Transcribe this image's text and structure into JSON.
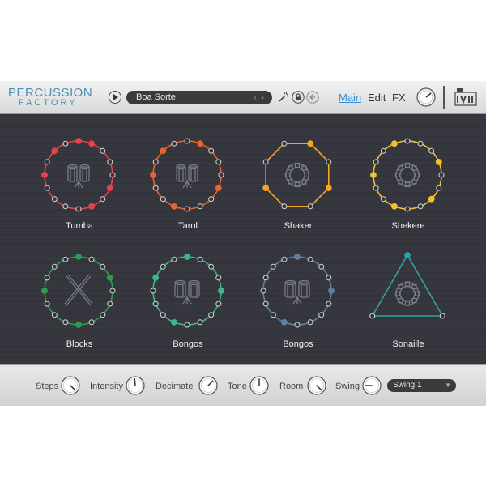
{
  "header": {
    "logo_line1": "PERCUSSION",
    "logo_line2": "FACTORY",
    "preset": "Boa Sorte",
    "preset_arrows": "‹ ›",
    "tabs": [
      "Main",
      "Edit",
      "FX"
    ],
    "active_tab": "Main",
    "accent_color": "#3d8fd1"
  },
  "pads": [
    {
      "name": "Tumba",
      "color": "#e8414c",
      "icon": "conga-drums-icon",
      "shape": "circle-16-steps"
    },
    {
      "name": "Tarol",
      "color": "#e8652e",
      "icon": "snare-drums-icon",
      "shape": "circle-16-steps"
    },
    {
      "name": "Shaker",
      "color": "#f5a623",
      "icon": "tambourine-icon",
      "shape": "octagon-8-steps"
    },
    {
      "name": "Shekere",
      "color": "#f2c12e",
      "icon": "tambourine-icon",
      "shape": "circle-16-steps"
    },
    {
      "name": "Blocks",
      "color": "#2f9b4e",
      "icon": "crossed-sticks-icon",
      "shape": "circle-16-steps"
    },
    {
      "name": "Bongos",
      "color": "#3fb58f",
      "icon": "bongo-drums-icon",
      "shape": "circle-16-steps"
    },
    {
      "name": "Bongos",
      "color": "#5a82a8",
      "icon": "bongo-drums-icon",
      "shape": "circle-16-steps"
    },
    {
      "name": "Sonaille",
      "color": "#2aa3a8",
      "icon": "tambourine-icon",
      "shape": "triangle-3-steps"
    }
  ],
  "footer": {
    "controls": [
      {
        "label": "Steps"
      },
      {
        "label": "Intensity"
      },
      {
        "label": "Decimate"
      },
      {
        "label": "Tone"
      },
      {
        "label": "Room"
      },
      {
        "label": "Swing"
      }
    ],
    "swing_select": "Swing 1"
  }
}
